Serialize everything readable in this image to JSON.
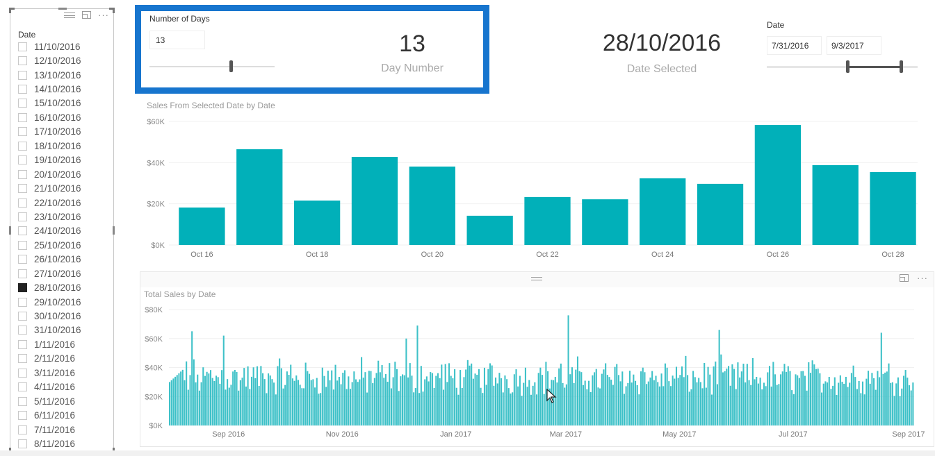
{
  "slicer": {
    "title": "Date",
    "items": [
      {
        "label": "11/10/2016",
        "checked": false
      },
      {
        "label": "12/10/2016",
        "checked": false
      },
      {
        "label": "13/10/2016",
        "checked": false
      },
      {
        "label": "14/10/2016",
        "checked": false
      },
      {
        "label": "15/10/2016",
        "checked": false
      },
      {
        "label": "16/10/2016",
        "checked": false
      },
      {
        "label": "17/10/2016",
        "checked": false
      },
      {
        "label": "18/10/2016",
        "checked": false
      },
      {
        "label": "19/10/2016",
        "checked": false
      },
      {
        "label": "20/10/2016",
        "checked": false
      },
      {
        "label": "21/10/2016",
        "checked": false
      },
      {
        "label": "22/10/2016",
        "checked": false
      },
      {
        "label": "23/10/2016",
        "checked": false
      },
      {
        "label": "24/10/2016",
        "checked": false
      },
      {
        "label": "25/10/2016",
        "checked": false
      },
      {
        "label": "26/10/2016",
        "checked": false
      },
      {
        "label": "27/10/2016",
        "checked": false
      },
      {
        "label": "28/10/2016",
        "checked": true
      },
      {
        "label": "29/10/2016",
        "checked": false
      },
      {
        "label": "30/10/2016",
        "checked": false
      },
      {
        "label": "31/10/2016",
        "checked": false
      },
      {
        "label": "1/11/2016",
        "checked": false
      },
      {
        "label": "2/11/2016",
        "checked": false
      },
      {
        "label": "3/11/2016",
        "checked": false
      },
      {
        "label": "4/11/2016",
        "checked": false
      },
      {
        "label": "5/11/2016",
        "checked": false
      },
      {
        "label": "6/11/2016",
        "checked": false
      },
      {
        "label": "7/11/2016",
        "checked": false
      },
      {
        "label": "8/11/2016",
        "checked": false
      }
    ]
  },
  "days_parameter": {
    "title": "Number of Days",
    "input_value": "13",
    "slider_fraction": 0.65
  },
  "day_number_card": {
    "value": "13",
    "label": "Day Number"
  },
  "date_selected_card": {
    "value": "28/10/2016",
    "label": "Date Selected"
  },
  "date_range": {
    "title": "Date",
    "start": "7/31/2016",
    "end": "9/3/2017",
    "handle_fractions": [
      0.535,
      0.89
    ]
  },
  "colors": {
    "accent_border": "#1775ce",
    "bar": "#01b0b9",
    "bar_bottom": "#3ec1c8"
  },
  "chart_data": [
    {
      "type": "bar",
      "title": "Sales From Selected Date by Date",
      "categories": [
        "Oct 16",
        "Oct 17",
        "Oct 18",
        "Oct 19",
        "Oct 20",
        "Oct 21",
        "Oct 22",
        "Oct 23",
        "Oct 24",
        "Oct 25",
        "Oct 26",
        "Oct 27",
        "Oct 28"
      ],
      "tick_labels": [
        "Oct 16",
        "",
        "Oct 18",
        "",
        "Oct 20",
        "",
        "Oct 22",
        "",
        "Oct 24",
        "",
        "Oct 26",
        "",
        "Oct 28"
      ],
      "values": [
        18200,
        46500,
        21600,
        42800,
        38100,
        14200,
        23300,
        22200,
        32400,
        29700,
        58300,
        38800,
        35400
      ],
      "ylim": [
        0,
        60000
      ],
      "yticks": [
        {
          "v": 0,
          "label": "$0K"
        },
        {
          "v": 20000,
          "label": "$20K"
        },
        {
          "v": 40000,
          "label": "$40K"
        },
        {
          "v": 60000,
          "label": "$60K"
        }
      ],
      "grid": true,
      "xlabel": "",
      "ylabel": ""
    },
    {
      "type": "bar",
      "title": "Total Sales by Date",
      "x_range": [
        "2016-07-31",
        "2017-09-03"
      ],
      "num_days": 400,
      "ylim": [
        0,
        80000
      ],
      "yticks": [
        {
          "v": 0,
          "label": "$0K"
        },
        {
          "v": 20000,
          "label": "$20K"
        },
        {
          "v": 40000,
          "label": "$40K"
        },
        {
          "v": 60000,
          "label": "$60K"
        },
        {
          "v": 80000,
          "label": "$80K"
        }
      ],
      "xticks": [
        {
          "day": 32,
          "label": "Sep 2016"
        },
        {
          "day": 93,
          "label": "Nov 2016"
        },
        {
          "day": 154,
          "label": "Jan 2017"
        },
        {
          "day": 213,
          "label": "Mar 2017"
        },
        {
          "day": 274,
          "label": "May 2017"
        },
        {
          "day": 335,
          "label": "Jul 2017"
        },
        {
          "day": 397,
          "label": "Sep 2017"
        }
      ],
      "peaks": [
        {
          "day": 12,
          "value": 65000
        },
        {
          "day": 29,
          "value": 62000
        },
        {
          "day": 133,
          "value": 69000
        },
        {
          "day": 127,
          "value": 60000
        },
        {
          "day": 214,
          "value": 76000
        },
        {
          "day": 295,
          "value": 66000
        },
        {
          "day": 382,
          "value": 64000
        }
      ],
      "typical_range": [
        10000,
        50000
      ],
      "grid": true,
      "xlabel": "",
      "ylabel": ""
    }
  ]
}
